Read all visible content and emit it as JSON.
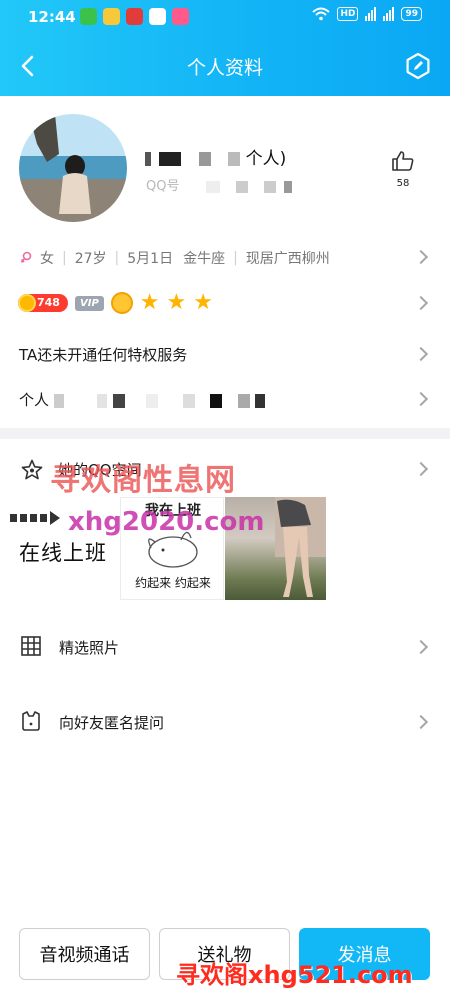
{
  "status_bar": {
    "time": "12:44",
    "network_label": "HD",
    "battery": "99"
  },
  "nav": {
    "title": "个人资料"
  },
  "profile": {
    "name_suffix": "个人)",
    "qq_prefix": "QQ号",
    "likes": "58"
  },
  "info": {
    "gender": "女",
    "age": "27岁",
    "birthday": "5月1日",
    "zodiac": "金牛座",
    "location": "现居广西柳州"
  },
  "badges": {
    "coin_count": "748",
    "vip_label": "VIP",
    "stars": [
      "★",
      "★",
      "★"
    ]
  },
  "privilege": {
    "text": "TA还未开通任何特权服务"
  },
  "signature": {
    "label": "个人"
  },
  "space": {
    "label": "她的QQ空间",
    "post_text": "在线上班",
    "meme_top": "我在上班",
    "meme_bottom": "约起来 约起来"
  },
  "list": {
    "photos_label": "精选照片",
    "anon_label": "向好友匿名提问"
  },
  "actions": {
    "call": "音视频通话",
    "gift": "送礼物",
    "message": "发消息"
  },
  "watermarks": {
    "wm1": "寻欢阁性息网",
    "wm2": "xhg2020.com",
    "wm3": "寻欢阁xhg521.com"
  },
  "colors": {
    "header": "#14b6f6",
    "primary_button": "#12b7f5",
    "coin_badge": "#ff3b2f",
    "star": "#ffb400"
  }
}
